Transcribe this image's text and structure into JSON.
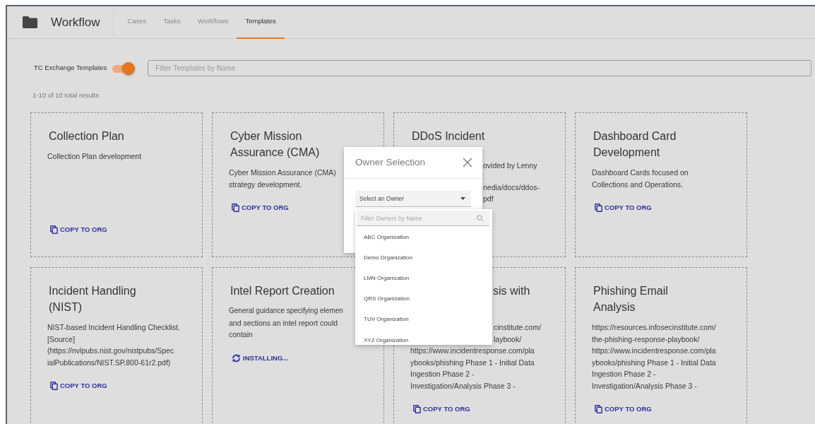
{
  "app": {
    "title": "Workflow"
  },
  "tabs": [
    {
      "label": "Cases",
      "selected": false
    },
    {
      "label": "Tasks",
      "selected": false
    },
    {
      "label": "Workflows",
      "selected": false
    },
    {
      "label": "Templates",
      "selected": true
    }
  ],
  "exchange_toggle": {
    "label": "TC Exchange Templates",
    "on": true
  },
  "filter": {
    "placeholder": "Filter Templates by Name"
  },
  "result_count": "1-10 of 10 total results",
  "cards": [
    {
      "title": "Collection Plan",
      "description": [
        "Collection Plan development"
      ],
      "action": {
        "kind": "copy",
        "label": "COPY TO ORG"
      }
    },
    {
      "title": "Cyber Mission Assurance (CMA)",
      "description": [
        "Cyber Mission Assurance (CMA)",
        "strategy development."
      ],
      "action": {
        "kind": "copy",
        "label": "COPY TO ORG"
      }
    },
    {
      "title": "DDoS Incident",
      "description_fragments": [
        "ovided by Lenny",
        "nedia/docs/ddos-",
        "pdf"
      ]
    },
    {
      "title": "Dashboard Card Development",
      "description": [
        "Dashboard Cards focused on",
        "Collections and Operations."
      ],
      "action": {
        "kind": "copy",
        "label": "COPY TO ORG"
      }
    },
    {
      "title": "Incident Handling (NIST)",
      "description": [
        "NIST-based Incident Handling Checklist.",
        "[Source]",
        "(https://nvlpubs.nist.gov/nistpubs/Spec",
        "ialPublications/NIST.SP.800-61r2.pdf)"
      ],
      "action": {
        "kind": "copy",
        "label": "COPY TO ORG"
      }
    },
    {
      "title": "Intel Report Creation",
      "description": [
        "General guidance specifying elemen",
        "and sections an intel report could",
        "contain"
      ],
      "action": {
        "kind": "installing",
        "label": "INSTALLING..."
      }
    },
    {
      "title": "sis with",
      "description_fragments": [
        "cinstitute.com/",
        "laybook/"
      ],
      "description": [
        "https://www.incidentresponse.com/pla",
        "ybooks/phishing Phase 1 - Initial Data",
        "Ingestion Phase 2 -",
        "Investigation/Analysis Phase 3 -"
      ],
      "action": {
        "kind": "copy",
        "label": "COPY TO ORG"
      }
    },
    {
      "title": "Phishing Email Analysis",
      "description": [
        "https://resources.infosecinstitute.com/",
        "the-phishing-response-playbook/",
        "https://www.incidentresponse.com/pla",
        "ybooks/phishing Phase 1 - Initial Data",
        "Ingestion Phase 2 -",
        "Investigation/Analysis Phase 3 -"
      ],
      "action": {
        "kind": "copy",
        "label": "COPY TO ORG"
      }
    }
  ],
  "owner_dialog": {
    "title": "Owner Selection",
    "select": {
      "placeholder": "Select an Owner",
      "expanded": true
    },
    "owner_filter": {
      "placeholder": "Filter Owners by Name"
    },
    "owners": [
      "ABC Organization",
      "Demo Organization",
      "LMN Organization",
      "QRS Organization",
      "TUV Organization",
      "XYZ Organization"
    ]
  }
}
